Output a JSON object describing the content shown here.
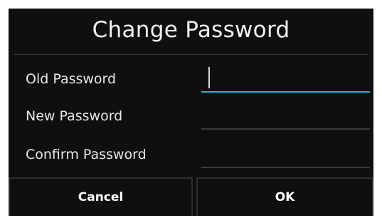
{
  "dialog": {
    "title": "Change Password",
    "fields": [
      {
        "label": "Old Password",
        "value": "",
        "placeholder": "",
        "focused": true
      },
      {
        "label": "New Password",
        "value": "",
        "placeholder": "",
        "focused": false
      },
      {
        "label": "Confirm Password",
        "value": "",
        "placeholder": "",
        "focused": false
      }
    ],
    "buttons": {
      "cancel_label": "Cancel",
      "ok_label": "OK"
    },
    "colors": {
      "background": "#0f0f0f",
      "accent": "#3fa7d6",
      "text": "#e8e8e8"
    }
  }
}
